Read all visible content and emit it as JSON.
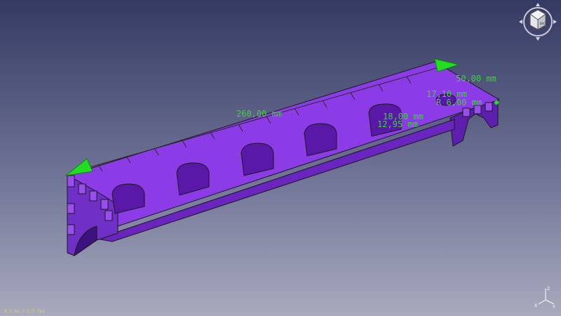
{
  "dimensions": {
    "length": "260,00 mm",
    "width": "50,00 mm",
    "hole_offset": "17,10 mm",
    "hole_radius": "R 6,00 mm",
    "slot_width": "18,00 mm",
    "slot_depth": "12,95 mm"
  },
  "status": {
    "fps": "5.7 ms / 1.7 fps"
  },
  "navcube": {
    "face_label": "BACK"
  },
  "colors": {
    "part_top": "#8c3ce6",
    "part_side": "#6a24c0",
    "edges": "#1a1a1a",
    "dimension": "#3cd23c",
    "arrow": "#22dd22"
  },
  "icons": {
    "navcube": "view-cube-icon",
    "axis": "axis-triad-icon"
  }
}
